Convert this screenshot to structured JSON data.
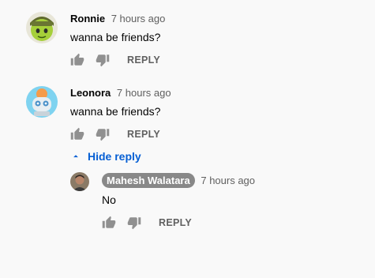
{
  "comments": [
    {
      "author": "Ronnie",
      "time": "7 hours ago",
      "text": "wanna be friends?",
      "reply_label": "REPLY",
      "avatar": "green-helmet-character-avatar"
    },
    {
      "author": "Leonora",
      "time": "7 hours ago",
      "text": "wanna be friends?",
      "reply_label": "REPLY",
      "avatar": "cartoon-robot-avatar"
    }
  ],
  "thread": {
    "hide_reply_label": "Hide reply"
  },
  "reply": {
    "author": "Mahesh Walatara",
    "time": "7 hours ago",
    "text": "No",
    "reply_label": "REPLY",
    "avatar": "photo-avatar"
  },
  "colors": {
    "background": "#f9f9f9",
    "link_blue": "#065fd4",
    "meta_gray": "#606060",
    "icon_gray": "#909090",
    "owner_chip": "#888888"
  }
}
